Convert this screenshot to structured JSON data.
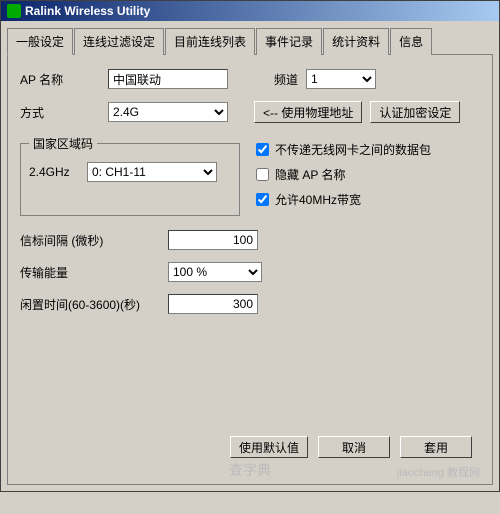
{
  "title": "Ralink Wireless Utility",
  "tabs": [
    "一般设定",
    "连线过滤设定",
    "目前连线列表",
    "事件记录",
    "统计资料",
    "信息"
  ],
  "activeTab": 0,
  "apNameLabel": "AP 名称",
  "apName": "中国联动",
  "channelLabel": "频道",
  "channel": "1",
  "channelOptions": [
    "1"
  ],
  "modeLabel": "方式",
  "mode": "2.4G",
  "modeOptions": [
    "2.4G"
  ],
  "useMacBtn": "<-- 使用物理地址",
  "authBtn": "认证加密设定",
  "regionGroup": "国家区域码",
  "band24Label": "2.4GHz",
  "band24": "0: CH1-11",
  "band24Options": [
    "0: CH1-11"
  ],
  "chk1": "不传递无线网卡之间的数据包",
  "chk1v": true,
  "chk2": "隐藏 AP 名称",
  "chk2v": false,
  "chk3": "允许40MHz带宽",
  "chk3v": true,
  "beaconLabel": "信标间隔 (微秒)",
  "beacon": "100",
  "txPowerLabel": "传输能量",
  "txPower": "100 %",
  "txPowerOptions": [
    "100 %"
  ],
  "idleLabel": "闲置时间(60-3600)(秒)",
  "idle": "300",
  "btnDefault": "使用默认值",
  "btnCancel": "取消",
  "btnApply": "套用",
  "watermark": "查字典",
  "wm2": "jiaocheng 教程网"
}
